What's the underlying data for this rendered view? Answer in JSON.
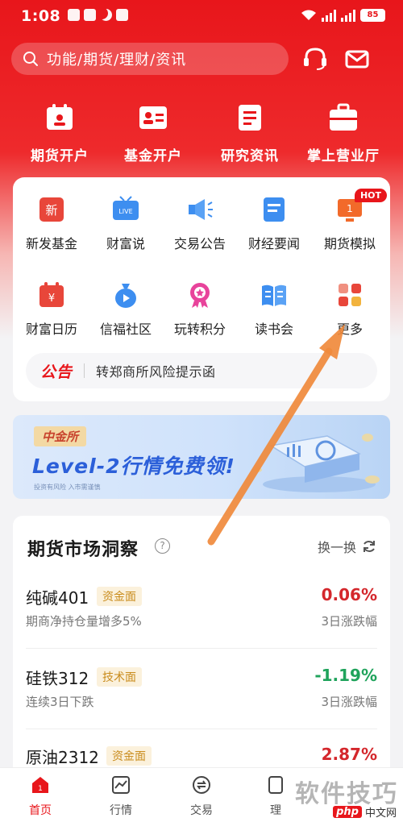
{
  "status_bar": {
    "time": "1:08",
    "battery": "85"
  },
  "search": {
    "placeholder": "功能/期货/理财/资讯"
  },
  "quick": [
    {
      "label": "期货开户"
    },
    {
      "label": "基金开户"
    },
    {
      "label": "研究资讯"
    },
    {
      "label": "掌上营业厅"
    }
  ],
  "grid": [
    {
      "label": "新发基金",
      "icon_text": "新"
    },
    {
      "label": "财富说",
      "icon_text": "LIVE"
    },
    {
      "label": "交易公告"
    },
    {
      "label": "财经要闻"
    },
    {
      "label": "期货模拟",
      "badge": "HOT",
      "icon_text": "1"
    },
    {
      "label": "财富日历",
      "icon_text": "¥"
    },
    {
      "label": "信福社区"
    },
    {
      "label": "玩转积分"
    },
    {
      "label": "读书会"
    },
    {
      "label": "更多"
    }
  ],
  "notice": {
    "tag": "公告",
    "text": "转郑商所风险提示函"
  },
  "banner": {
    "tag": "中金所",
    "title": "Level-2行情免费领!",
    "fine": "投资有风险 入市需谨慎"
  },
  "insight": {
    "title": "期货市场洞察",
    "help_icon": "?",
    "swap_label": "换一换",
    "rows": [
      {
        "name": "纯碱401",
        "badge": "资金面",
        "desc": "期商净持仓量增多5%",
        "pct": "0.06%",
        "pct_label": "3日涨跌幅",
        "color": "#d4272c"
      },
      {
        "name": "硅铁312",
        "badge": "技术面",
        "desc": "连续3日下跌",
        "pct": "-1.19%",
        "pct_label": "3日涨跌幅",
        "color": "#1fa35b"
      },
      {
        "name": "原油2312",
        "badge": "资金面",
        "desc": "",
        "pct": "2.87%",
        "pct_label": "",
        "color": "#d4272c"
      }
    ]
  },
  "tabs": [
    {
      "label": "首页",
      "icon_text": "1"
    },
    {
      "label": "行情"
    },
    {
      "label": "交易"
    },
    {
      "label": "理"
    }
  ],
  "watermark": {
    "text": "软件技巧",
    "site_logo": "php",
    "site": "中文网"
  },
  "colors": {
    "brand_red": "#e8161b",
    "up": "#d4272c",
    "down": "#1fa35b",
    "annotation_arrow": "#f08a3c"
  }
}
